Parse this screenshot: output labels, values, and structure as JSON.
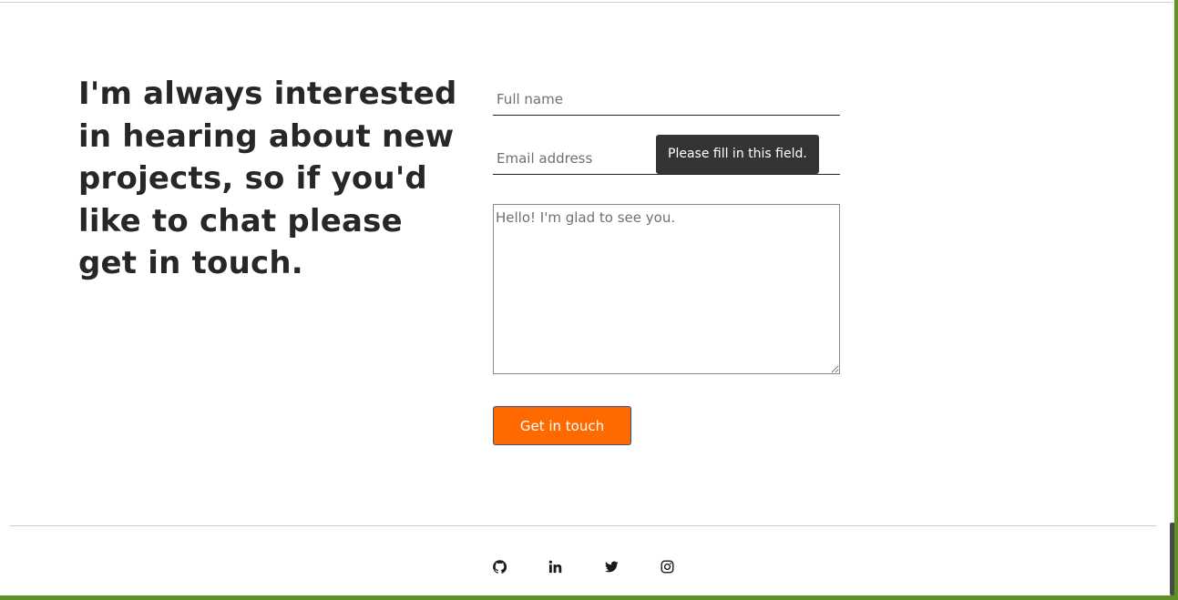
{
  "contact": {
    "headline": "I'm always interested in hearing about new projects, so if you'd like to chat please get in touch.",
    "form": {
      "full_name_placeholder": "Full name",
      "email_placeholder": "Email address",
      "message_placeholder": "Hello! I'm glad to see you.",
      "submit_label": "Get in touch",
      "validation_tooltip": "Please fill in this field."
    }
  },
  "footer": {
    "social": [
      {
        "icon": "github-icon"
      },
      {
        "icon": "linkedin-icon"
      },
      {
        "icon": "twitter-icon"
      },
      {
        "icon": "instagram-icon"
      }
    ]
  },
  "colors": {
    "accent": "#ff6a00",
    "frame": "#5f9128",
    "tooltip_bg": "#343434",
    "text": "#272727"
  }
}
